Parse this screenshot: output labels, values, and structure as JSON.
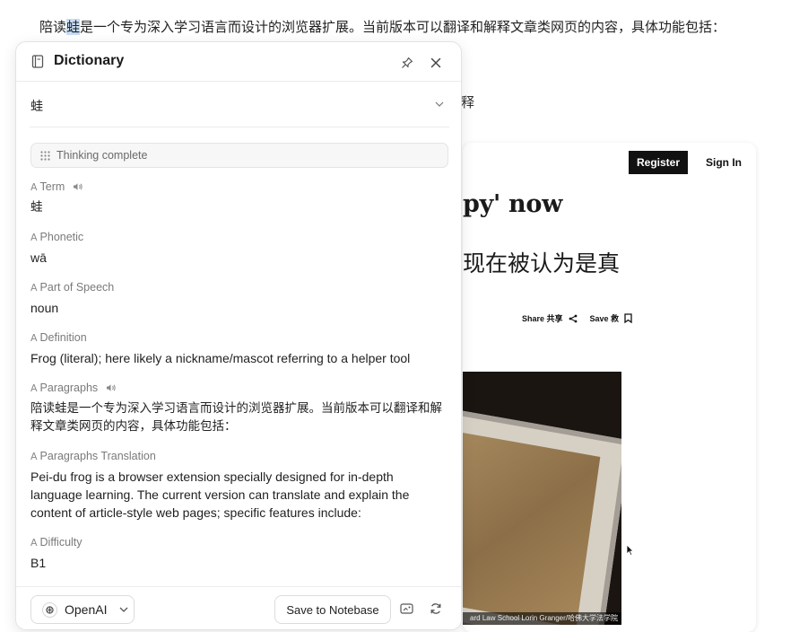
{
  "background": {
    "paragraph": {
      "before": "陪读",
      "highlight": "蛙",
      "after": "是一个专为深入学习语言而设计的浏览器扩展。当前版本可以翻译和解释文章类网页的内容，具体功能包括："
    },
    "fragment": "释",
    "article": {
      "register_label": "Register",
      "signin_label": "Sign In",
      "headline_fragment": "py' now",
      "headline_cn_fragment": "现在被认为是真",
      "share_label": "Share 共享",
      "save_label": "Save 救",
      "photo_caption": "ard Law School Lorin Granger/哈佛大学法学院"
    }
  },
  "panel": {
    "title": "Dictionary",
    "selected_word": "蛙",
    "status": "Thinking complete",
    "fields": {
      "term": {
        "label": "Term",
        "value": "蛙"
      },
      "phonetic": {
        "label": "Phonetic",
        "value": "wā"
      },
      "pos": {
        "label": "Part of Speech",
        "value": "noun"
      },
      "definition": {
        "label": "Definition",
        "value": "Frog (literal); here likely a nickname/mascot referring to a helper tool"
      },
      "paragraphs": {
        "label": "Paragraphs",
        "value": "陪读蛙是一个专为深入学习语言而设计的浏览器扩展。当前版本可以翻译和解释文章类网页的内容，具体功能包括："
      },
      "paragraphs_translation": {
        "label": "Paragraphs Translation",
        "value": "Pei-du frog is a browser extension specially designed for in-depth language learning. The current version can translate and explain the content of article-style web pages; specific features include:"
      },
      "difficulty": {
        "label": "Difficulty",
        "value": "B1"
      }
    },
    "footer": {
      "model": "OpenAI",
      "save_button": "Save to Notebase"
    }
  },
  "icons": {
    "title": "book-icon",
    "pin": "pin-icon",
    "close": "close-icon",
    "status": "grid-dots-icon",
    "field": "text-a-icon",
    "speaker": "speaker-icon",
    "model": "openai-logo-icon",
    "screenshot": "image-icon",
    "refresh": "refresh-icon"
  }
}
